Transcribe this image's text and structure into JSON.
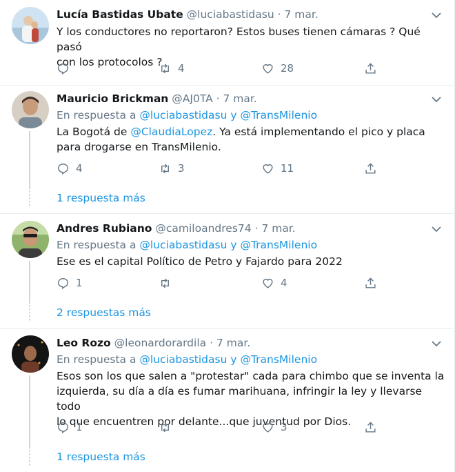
{
  "tweets": [
    {
      "name": "Lucía Bastidas Ubate",
      "handle": "@luciabastidasu",
      "date": "7 mar.",
      "text1": "Y los conductores no reportaron? Estos buses tienen cámaras ? Qué pasó",
      "text2": "con los protocolos ?",
      "retweets": "4",
      "likes": "28",
      "avatar_icon": "profile-photo"
    },
    {
      "name": "Mauricio Brickman",
      "handle": "@AJ0TA",
      "date": "7 mar.",
      "reply_prefix": "En respuesta a",
      "reply_user1": "@luciabastidasu",
      "reply_and": "y",
      "reply_user2": "@TransMilenio",
      "text_pre": "La Bogotá de ",
      "text_mention": "@ClaudiaLopez",
      "text_post": ". Ya está implementando el pico y placa",
      "text2": "para drogarse en TransMilenio.",
      "replies": "4",
      "retweets": "3",
      "likes": "11",
      "more": "1 respuesta más"
    },
    {
      "name": "Andres Rubiano",
      "handle": "@camiloandres74",
      "date": "7 mar.",
      "reply_prefix": "En respuesta a",
      "reply_user1": "@luciabastidasu",
      "reply_and": "y",
      "reply_user2": "@TransMilenio",
      "text1": "Ese es el capital Político de Petro y Fajardo para 2022",
      "replies": "1",
      "likes": "4",
      "more": "2 respuestas más"
    },
    {
      "name": "Leo Rozo",
      "handle": "@leonardorardila",
      "date": "7 mar.",
      "reply_prefix": "En respuesta a",
      "reply_user1": "@luciabastidasu",
      "reply_and": "y",
      "reply_user2": "@TransMilenio",
      "text1": "Esos son los que salen a \"protestar\" cada para chimbo que se inventa la",
      "text2": "izquierda, su día a día es fumar marihuana, infringir la ley y llevarse todo",
      "text3": "lo que encuentren por delante...que juventud por Dios.",
      "replies": "1",
      "likes": "3",
      "more": "1 respuesta más"
    }
  ],
  "separator": "·",
  "colors": {
    "link": "#1b95e0",
    "muted": "#657786",
    "text": "#14171a",
    "line": "#ccd6dd"
  }
}
